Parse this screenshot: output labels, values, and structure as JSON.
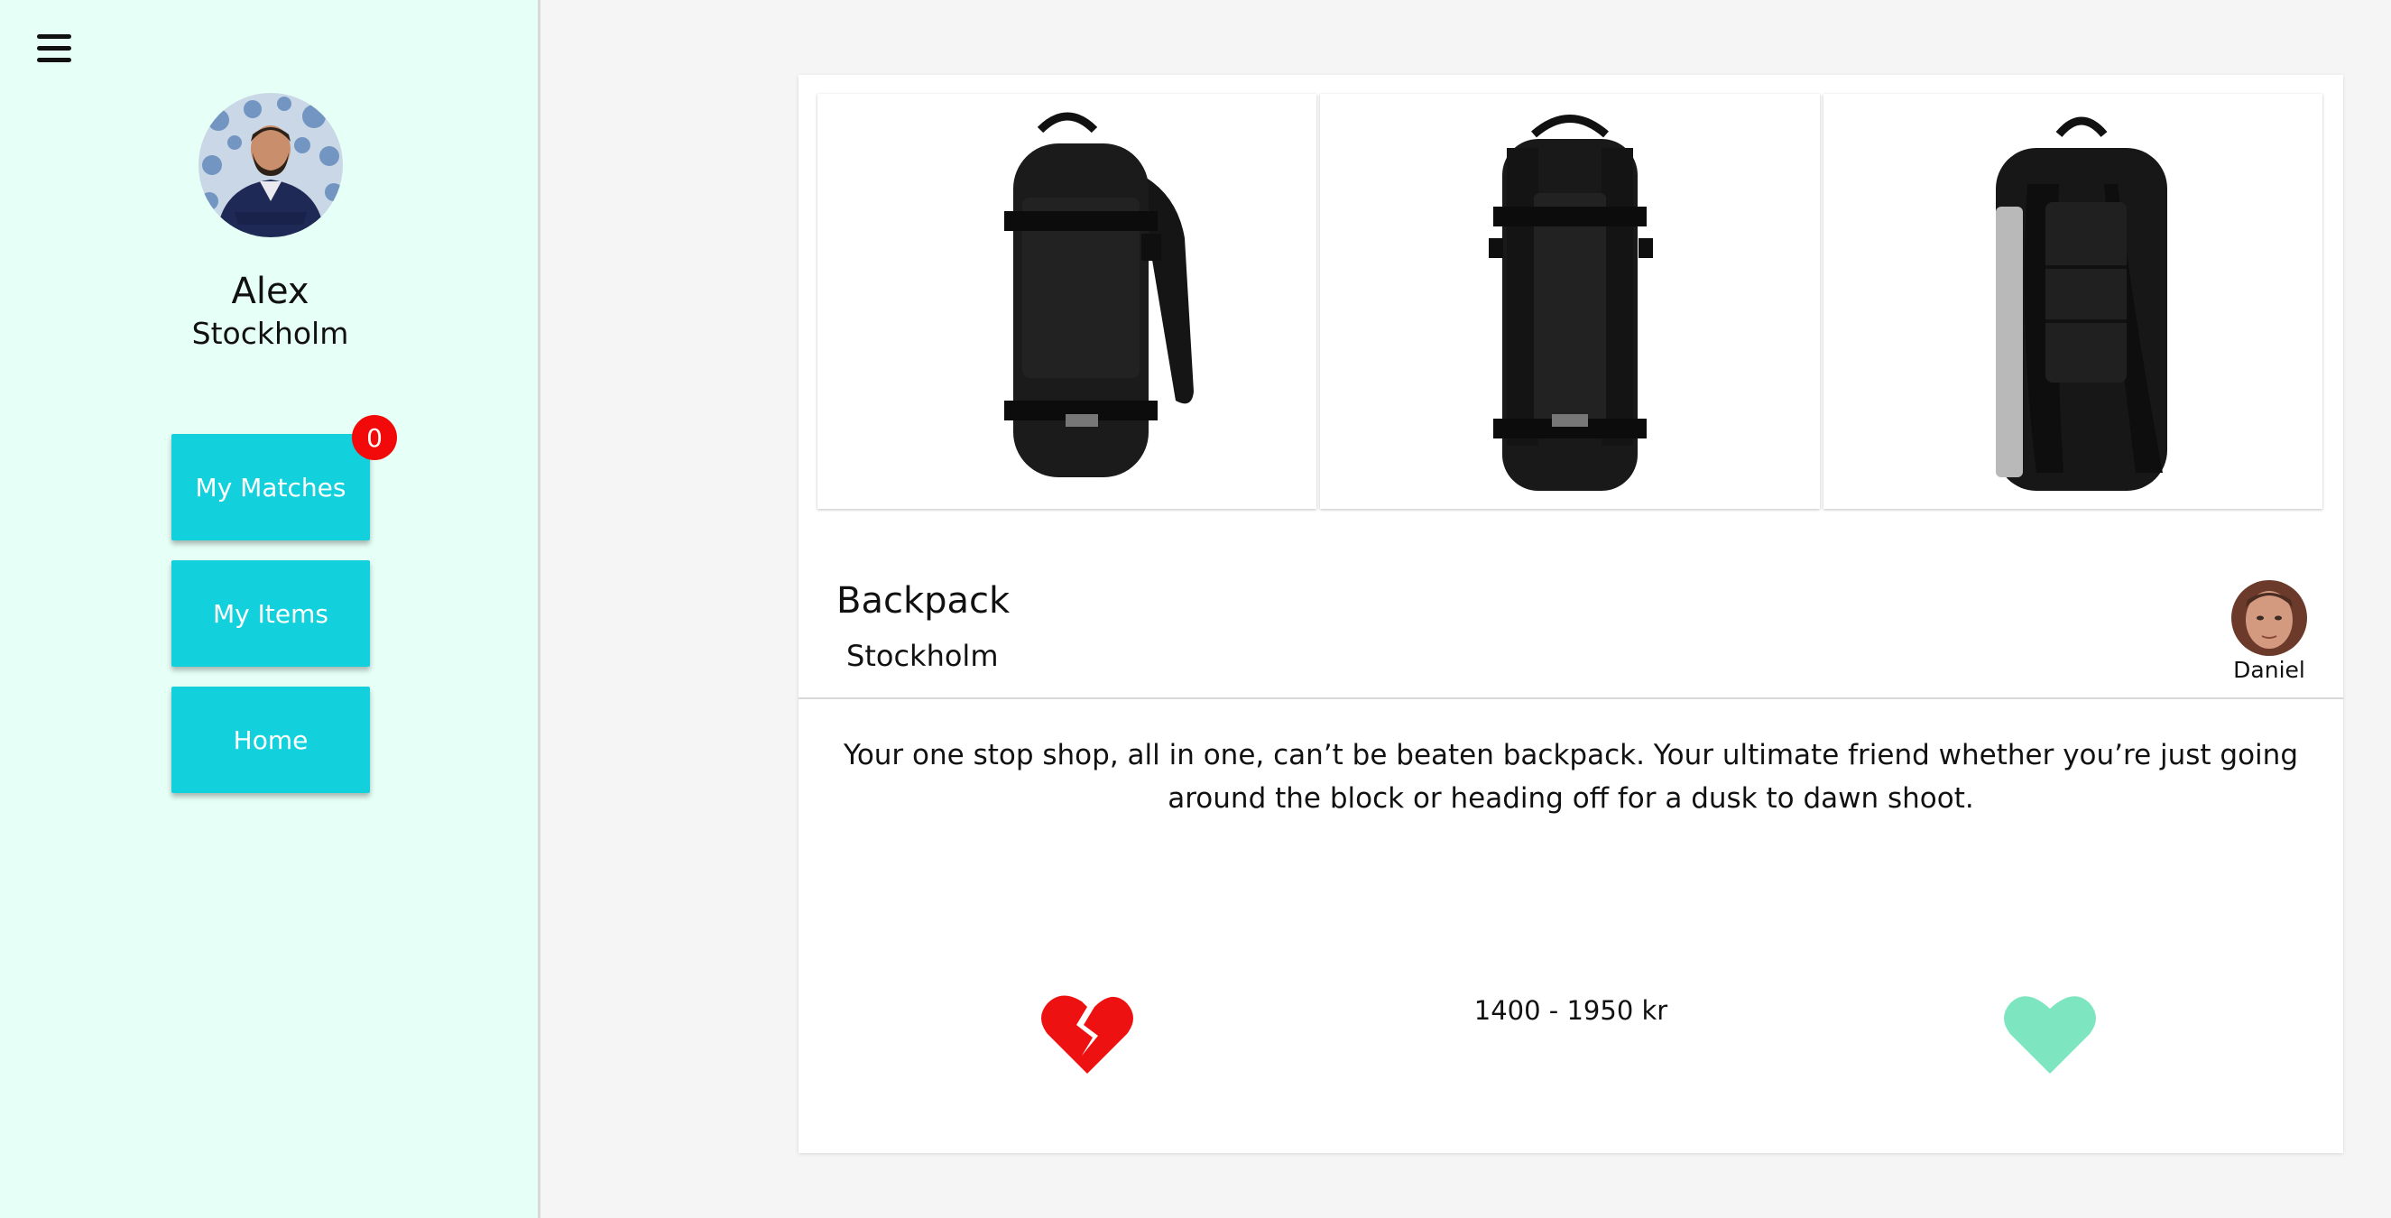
{
  "sidebar": {
    "menu_icon": "hamburger-menu-icon",
    "user": {
      "name": "Alex",
      "city": "Stockholm",
      "avatar_icon": "user-avatar"
    },
    "nav": [
      {
        "label": "My Matches",
        "badge": "0"
      },
      {
        "label": "My Items"
      },
      {
        "label": "Home"
      }
    ],
    "colors": {
      "background": "#e6fff7",
      "button": "#12d1dc",
      "badge": "#f20a0a"
    }
  },
  "item": {
    "title": "Backpack",
    "city": "Stockholm",
    "owner": {
      "name": "Daniel",
      "avatar_icon": "owner-avatar"
    },
    "images": [
      "backpack-side-view",
      "backpack-front-view",
      "backpack-back-view"
    ],
    "description": "Your one stop shop, all in one, can’t be beaten backpack. Your ultimate friend whether you’re just going around the block or heading off for a dusk to dawn shoot.",
    "price": "1400 - 1950 kr",
    "actions": {
      "dislike_icon": "broken-heart-icon",
      "like_icon": "heart-icon",
      "dislike_color": "#ee1111",
      "like_color": "#7de6c0"
    }
  }
}
